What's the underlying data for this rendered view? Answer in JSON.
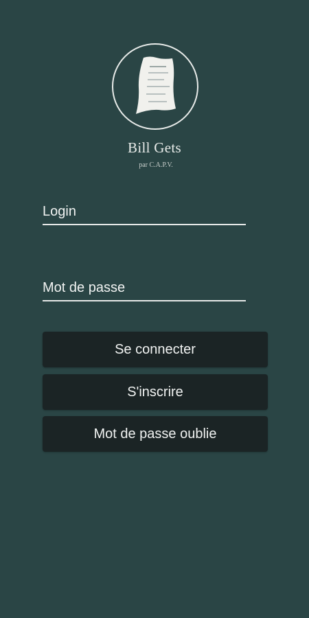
{
  "brand": {
    "title": "Bill Gets",
    "subtitle": "par C.A.P.V.",
    "logo_icon": "receipt-icon"
  },
  "form": {
    "login_placeholder": "Login",
    "password_placeholder": "Mot de passe",
    "login_value": "",
    "password_value": ""
  },
  "buttons": {
    "connect_label": "Se connecter",
    "signup_label": "S'inscrire",
    "forgot_label": "Mot de passe oublie"
  },
  "colors": {
    "background": "#2a4545",
    "button": "#1b2425",
    "text": "#f1f3f2"
  }
}
